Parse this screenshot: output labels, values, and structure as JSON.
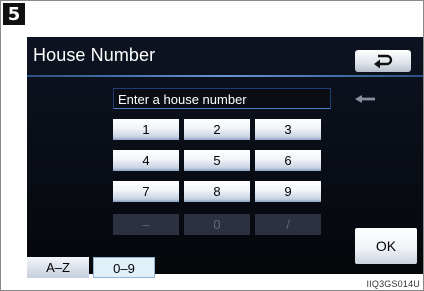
{
  "step_badge": "5",
  "screen": {
    "title": "House Number",
    "back_icon": "return-arrow-icon",
    "entry_placeholder": "Enter a house number",
    "backspace_icon": "backspace-arrow-icon",
    "keypad": {
      "row1": [
        "1",
        "2",
        "3"
      ],
      "row2": [
        "4",
        "5",
        "6"
      ],
      "row3": [
        "7",
        "8",
        "9"
      ],
      "row4": [
        "–",
        "0",
        "/"
      ]
    },
    "ok_label": "OK",
    "mode_az_label": "A–Z",
    "mode_09_label": "0–9"
  },
  "caption": "IIQ3GS014U",
  "colors": {
    "screen_bg": "#05070b",
    "accent_line": "#6b93cf",
    "key_face": "#f1f4f9",
    "selected_mode": "#dff0f9"
  }
}
